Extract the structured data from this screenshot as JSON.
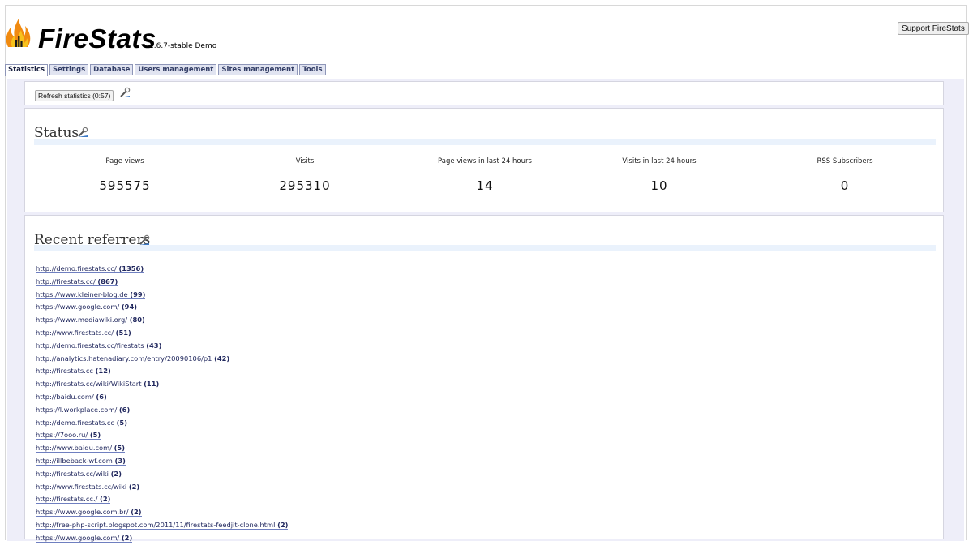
{
  "header": {
    "brand": "FireStats",
    "version": "1.6.7-stable Demo",
    "support_button": "Support FireStats"
  },
  "tabs": [
    {
      "label": "Statistics",
      "active": true
    },
    {
      "label": "Settings"
    },
    {
      "label": "Database"
    },
    {
      "label": "Users management"
    },
    {
      "label": "Sites management"
    },
    {
      "label": "Tools"
    }
  ],
  "toolbar": {
    "refresh_label": "Refresh statistics (0:57)"
  },
  "status": {
    "title": "Status",
    "stats": [
      {
        "label": "Page views",
        "value": "595575"
      },
      {
        "label": "Visits",
        "value": "295310"
      },
      {
        "label": "Page views in last 24 hours",
        "value": "14"
      },
      {
        "label": "Visits in last 24 hours",
        "value": "10"
      },
      {
        "label": "RSS Subscribers",
        "value": "0"
      }
    ]
  },
  "referrers": {
    "title": "Recent referrers",
    "items": [
      {
        "url": "http://demo.firestats.cc/",
        "count": "(1356)"
      },
      {
        "url": "http://firestats.cc/",
        "count": "(867)"
      },
      {
        "url": "https://www.kleiner-blog.de",
        "count": "(99)"
      },
      {
        "url": "https://www.google.com/",
        "count": "(94)"
      },
      {
        "url": "https://www.mediawiki.org/",
        "count": "(80)"
      },
      {
        "url": "http://www.firestats.cc/",
        "count": "(51)"
      },
      {
        "url": "http://demo.firestats.cc/firestats",
        "count": "(43)"
      },
      {
        "url": "http://analytics.hatenadiary.com/entry/20090106/p1",
        "count": "(42)"
      },
      {
        "url": "http://firestats.cc",
        "count": "(12)"
      },
      {
        "url": "http://firestats.cc/wiki/WikiStart",
        "count": "(11)"
      },
      {
        "url": "http://baidu.com/",
        "count": "(6)"
      },
      {
        "url": "https://l.workplace.com/",
        "count": "(6)"
      },
      {
        "url": "http://demo.firestats.cc",
        "count": "(5)"
      },
      {
        "url": "https://7ooo.ru/",
        "count": "(5)"
      },
      {
        "url": "http://www.baidu.com/",
        "count": "(5)"
      },
      {
        "url": "http://illbeback-wf.com",
        "count": "(3)"
      },
      {
        "url": "http://firestats.cc/wiki",
        "count": "(2)"
      },
      {
        "url": "http://www.firestats.cc/wiki",
        "count": "(2)"
      },
      {
        "url": "http://firestats.cc./",
        "count": "(2)"
      },
      {
        "url": "https://www.google.com.br/",
        "count": "(2)"
      },
      {
        "url": "http://free-php-script.blogspot.com/2011/11/firestats-feedjit-clone.html",
        "count": "(2)"
      },
      {
        "url": "https://www.google.com/",
        "count": "(2)"
      }
    ]
  },
  "icons": {
    "logo": "firestats-flame-logo",
    "config": "configure-tool-icon"
  }
}
